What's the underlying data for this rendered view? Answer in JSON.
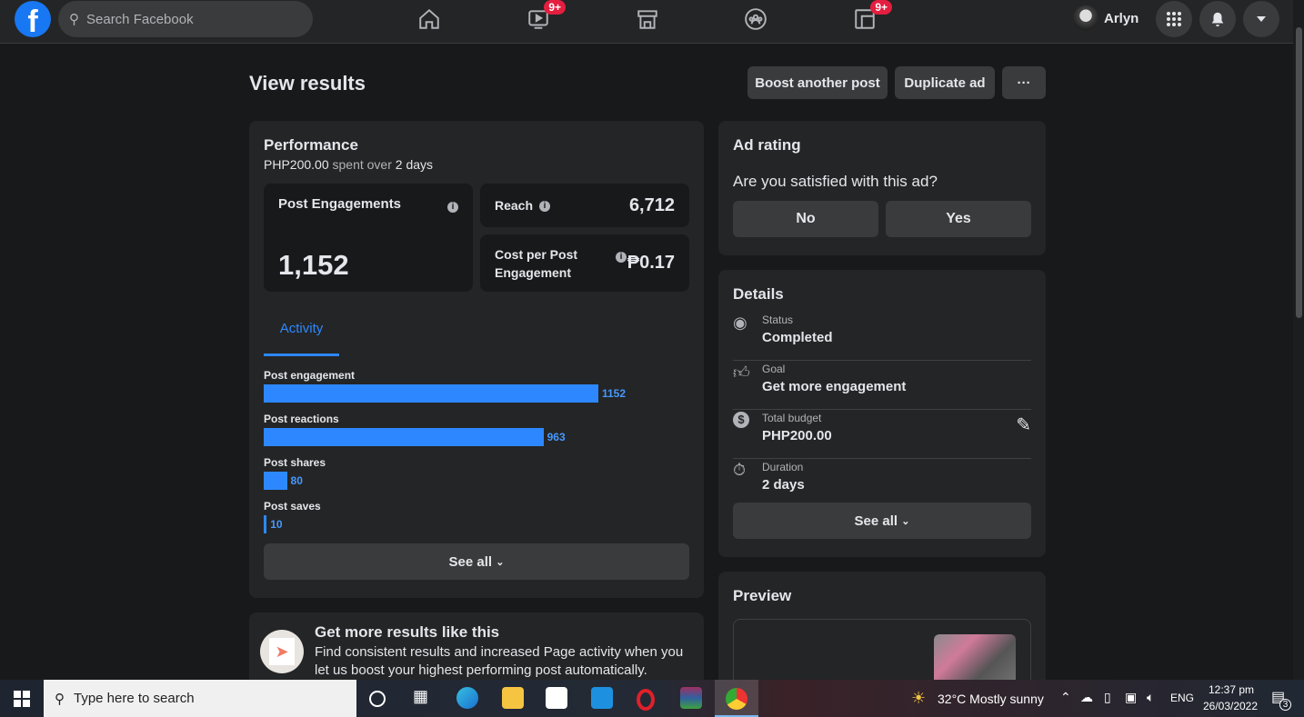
{
  "topbar": {
    "logo": "f",
    "search_placeholder": "Search Facebook",
    "watch_badge": "9+",
    "gaming_badge": "9+",
    "user_name": "Arlyn"
  },
  "header": {
    "title": "View results",
    "boost_another": "Boost another post",
    "duplicate": "Duplicate ad",
    "more": "···"
  },
  "performance": {
    "title": "Performance",
    "spent_amount": "PHP200.00",
    "spent_text": " spent over ",
    "days": "2 days",
    "post_engagements_label": "Post Engagements",
    "post_engagements_value": "1,152",
    "reach_label": "Reach",
    "reach_value": "6,712",
    "cpe_label": "Cost per Post Engagement",
    "cpe_value": "₱0.17",
    "tab": "Activity",
    "see_all": "See all"
  },
  "chart_data": {
    "type": "bar",
    "orientation": "horizontal",
    "categories": [
      "Post engagement",
      "Post reactions",
      "Post shares",
      "Post saves"
    ],
    "values": [
      1152,
      963,
      80,
      10
    ],
    "bar_color": "#2d88ff"
  },
  "ad_rating": {
    "title": "Ad rating",
    "question": "Are you satisfied with this ad?",
    "no": "No",
    "yes": "Yes"
  },
  "details": {
    "title": "Details",
    "rows": [
      {
        "label": "Status",
        "value": "Completed",
        "icon": "status-radio-icon"
      },
      {
        "label": "Goal",
        "value": "Get more engagement",
        "icon": "thumbs-up-icon"
      },
      {
        "label": "Total budget",
        "value": "PHP200.00",
        "icon": "dollar-icon"
      },
      {
        "label": "Duration",
        "value": "2 days",
        "icon": "stopwatch-icon"
      }
    ],
    "see_all": "See all"
  },
  "preview": {
    "title": "Preview"
  },
  "promo": {
    "title": "Get more results like this",
    "body": "Find consistent results and increased Page activity when you let us boost your highest performing post automatically."
  },
  "taskbar": {
    "search_placeholder": "Type here to search",
    "weather": "32°C  Mostly sunny",
    "lang": "ENG",
    "time": "12:37 pm",
    "date": "26/03/2022",
    "notifications": "3"
  }
}
